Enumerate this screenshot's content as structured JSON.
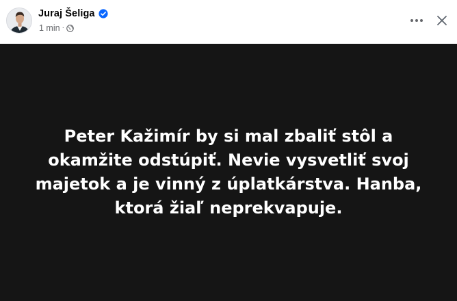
{
  "post": {
    "author": "Juraj Šeliga",
    "time": "1 min",
    "separator": "·",
    "body": "Peter Kažimír by si mal zbaliť stôl a okamžite odstúpiť. Nevie vysvetliť svoj majetok a je vinný z úplatkárstva. Hanba, ktorá žiaľ neprekvapuje."
  },
  "icons": {
    "verified": "verified-badge-icon",
    "audience": "globe-icon",
    "more": "more-options-icon",
    "close": "close-icon"
  },
  "colors": {
    "verified_badge": "#0866ff",
    "post_background": "#151515",
    "post_text": "#ffffff",
    "author_text": "#050505",
    "meta_text": "#65676b"
  }
}
